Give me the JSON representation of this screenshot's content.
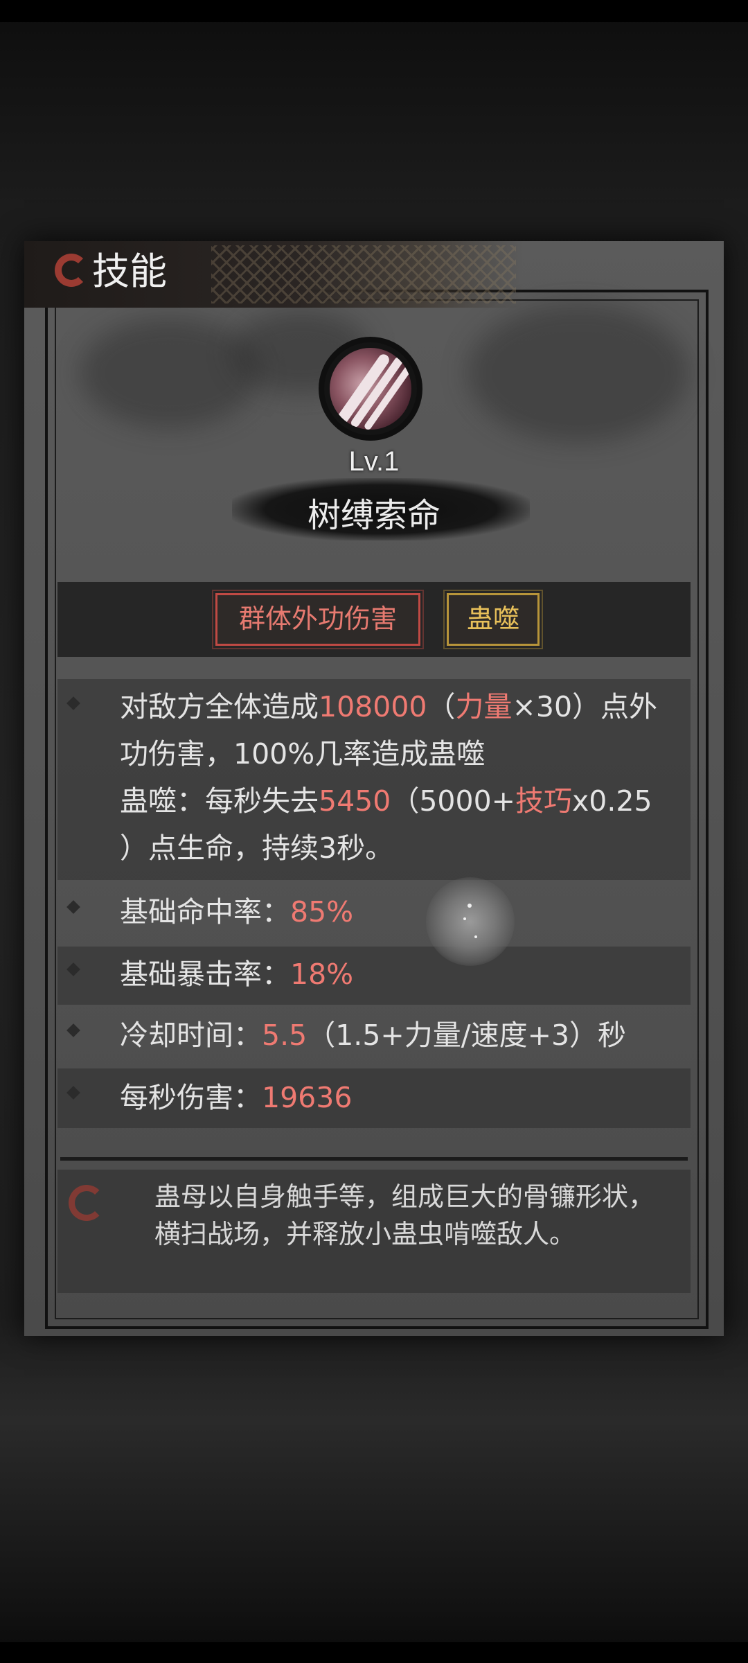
{
  "header": {
    "title": "技能",
    "icon": "crescent-emblem-icon"
  },
  "skill": {
    "icon": "tentacle-scythe-icon",
    "level": "Lv.1",
    "name": "树缚索命"
  },
  "tags": [
    {
      "label": "群体外功伤害",
      "color": "#e77a70"
    },
    {
      "label": "蛊噬",
      "color": "#e8c05a"
    }
  ],
  "effect": {
    "line1": {
      "a": "对敌方全体造成",
      "value": "108000",
      "b": "（",
      "stat": "力量",
      "c": "×30）点外"
    },
    "line2": "功伤害，100%几率造成蛊噬",
    "line3": {
      "a": "蛊噬：每秒失去",
      "value": "5450",
      "b": "（5000+",
      "stat": "技巧",
      "c": "x0.25"
    },
    "line4": "）点生命，持续3秒。"
  },
  "stats": [
    {
      "label": "基础命中率：",
      "value": "85%",
      "suffix": ""
    },
    {
      "label": "基础暴击率：",
      "value": "18%",
      "suffix": ""
    },
    {
      "label": "冷却时间：",
      "value": "5.5",
      "suffix": "（1.5+力量/速度+3）秒"
    },
    {
      "label": "每秒伤害：",
      "value": "19636",
      "suffix": ""
    }
  ],
  "description": {
    "icon": "crescent-emblem-icon",
    "line1": "蛊母以自身触手等，组成巨大的骨镰形状，",
    "line2": "横扫战场，并释放小蛊虫啃噬敌人。"
  },
  "colors": {
    "highlight": "#ef7a72",
    "tag_red": "#c04a44",
    "tag_gold": "#b8953a"
  }
}
